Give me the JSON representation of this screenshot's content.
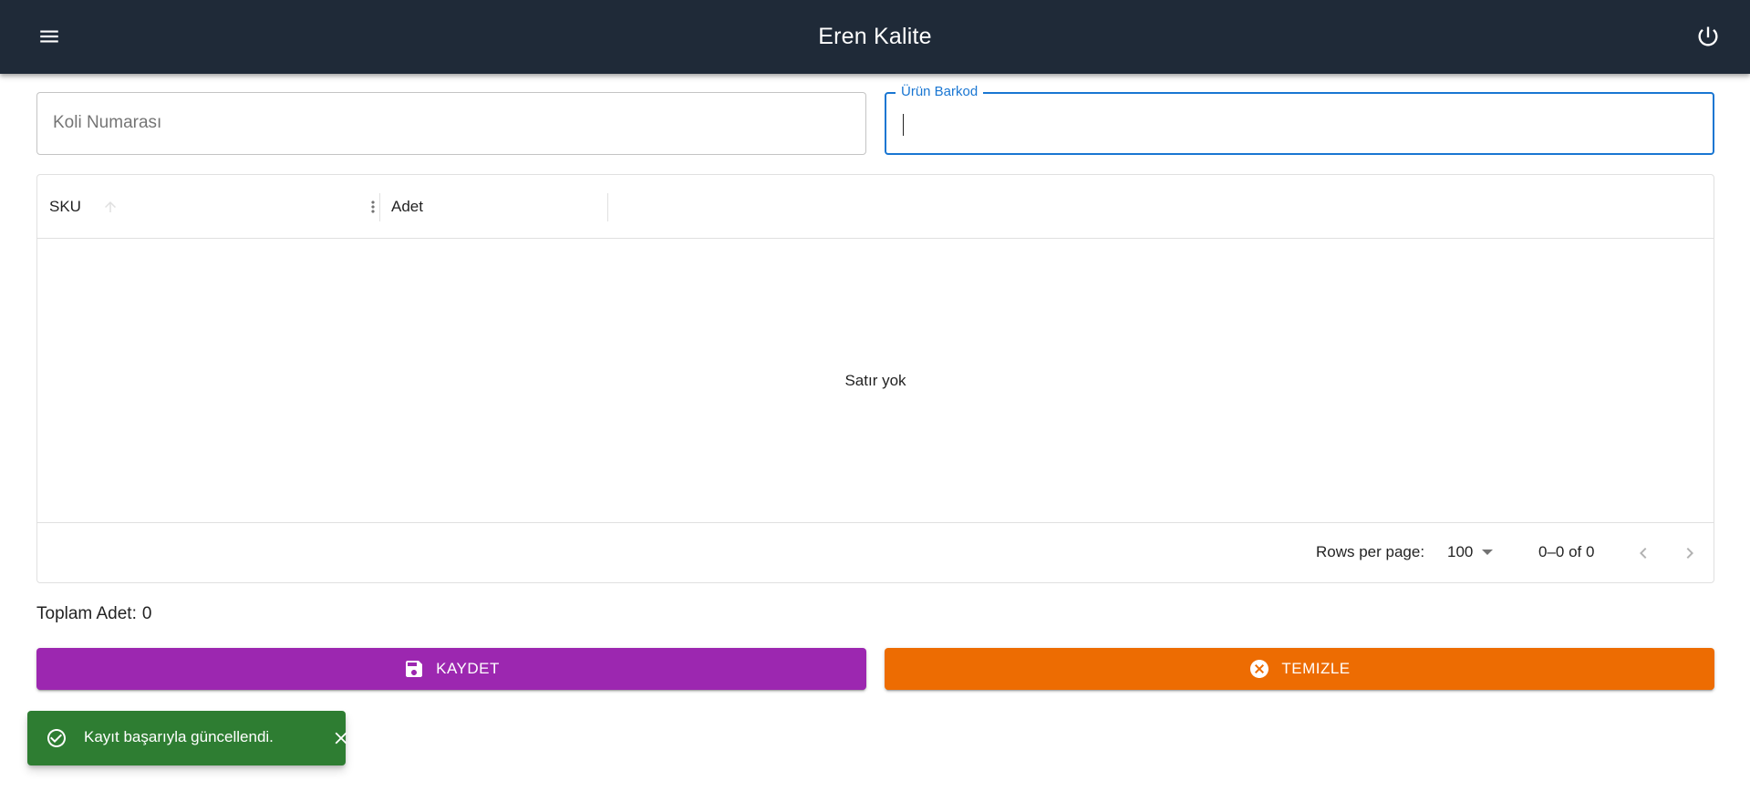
{
  "appbar": {
    "title": "Eren Kalite",
    "background": "#1f2a38",
    "menu_icon": "menu-icon",
    "logout_icon": "power-icon"
  },
  "form": {
    "koli_label": "Koli Numarası",
    "koli_value": "",
    "barkod_label": "Ürün Barkod",
    "barkod_value": "",
    "focus_color": "#1976d2"
  },
  "grid": {
    "columns": [
      {
        "label": "SKU"
      },
      {
        "label": "Adet"
      }
    ],
    "rows": [],
    "empty_text": "Satır yok",
    "footer": {
      "rows_per_page_label": "Rows per page:",
      "rows_per_page_value": "100",
      "page_range": "0–0 of 0"
    }
  },
  "summary": {
    "total_label": "Toplam Adet:",
    "total_value": "0"
  },
  "actions": {
    "save_label": "KAYDET",
    "save_color": "#9c27b0",
    "clear_label": "TEMIZLE",
    "clear_color": "#ed6c02"
  },
  "snackbar": {
    "message": "Kayıt başarıyla güncellendi.",
    "color": "#2e7d32"
  }
}
